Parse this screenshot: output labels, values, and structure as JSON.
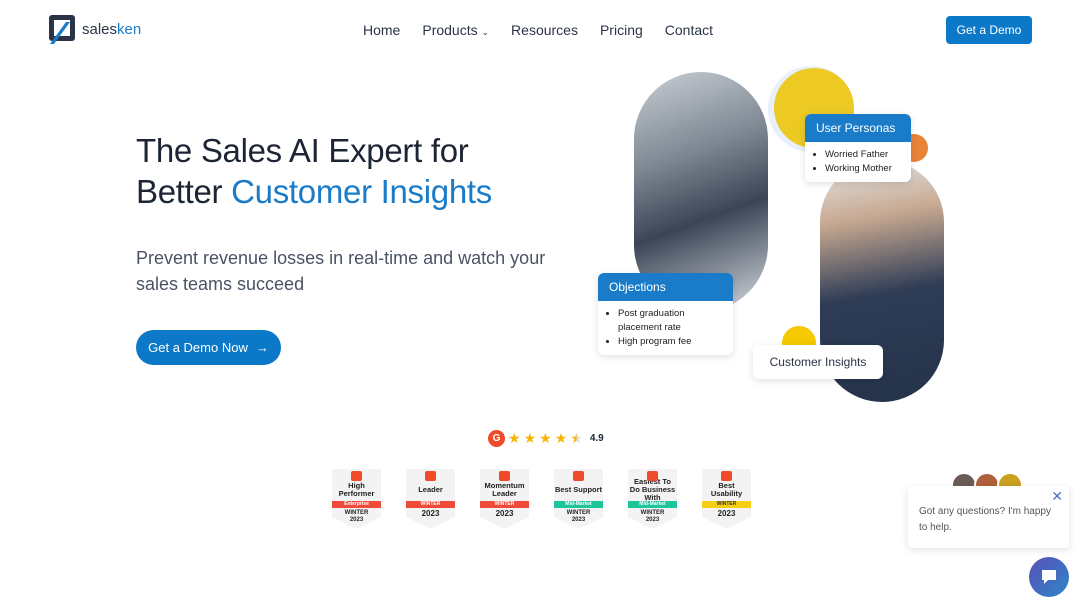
{
  "brand": {
    "name_a": "sales",
    "name_b": "ken"
  },
  "nav": {
    "items": [
      "Home",
      "Products",
      "Resources",
      "Pricing",
      "Contact"
    ],
    "cta": "Get a Demo"
  },
  "hero": {
    "title_line1": "The Sales AI Expert for",
    "title_line2_a": "Better ",
    "title_line2_b": "Customer Insights",
    "subtitle": "Prevent revenue losses in real-time and watch your sales teams succeed",
    "cta": "Get a Demo Now",
    "accent_color": "#1a7cc8"
  },
  "illustration": {
    "personas_title": "User Personas",
    "personas": [
      "Worried Father",
      "Working Mother"
    ],
    "objections_title": "Objections",
    "objections": [
      "Post graduation placement rate",
      "High program fee"
    ],
    "insights_label": "Customer Insights"
  },
  "rating": {
    "score": "4.9",
    "stars": 4.5
  },
  "badges": [
    {
      "title": "High Performer",
      "ribbon": "Enterprise",
      "season": "WINTER",
      "year": "2023",
      "color": "#f04a3a"
    },
    {
      "title": "Leader",
      "ribbon": "WINTER",
      "season": "",
      "year": "2023",
      "color": "#f04a3a"
    },
    {
      "title": "Momentum Leader",
      "ribbon": "WINTER",
      "season": "",
      "year": "2023",
      "color": "#f04a3a"
    },
    {
      "title": "Best Support",
      "ribbon": "Mid-Market",
      "season": "WINTER",
      "year": "2023",
      "color": "#1fc59a"
    },
    {
      "title": "Easiest To Do Business With",
      "ribbon": "Mid-Market",
      "season": "WINTER",
      "year": "2023",
      "color": "#1fc59a"
    },
    {
      "title": "Best Usability",
      "ribbon": "WINTER",
      "season": "",
      "year": "2023",
      "color": "#f7cf12"
    }
  ],
  "chat": {
    "message": "Got any questions? I'm happy to help."
  }
}
